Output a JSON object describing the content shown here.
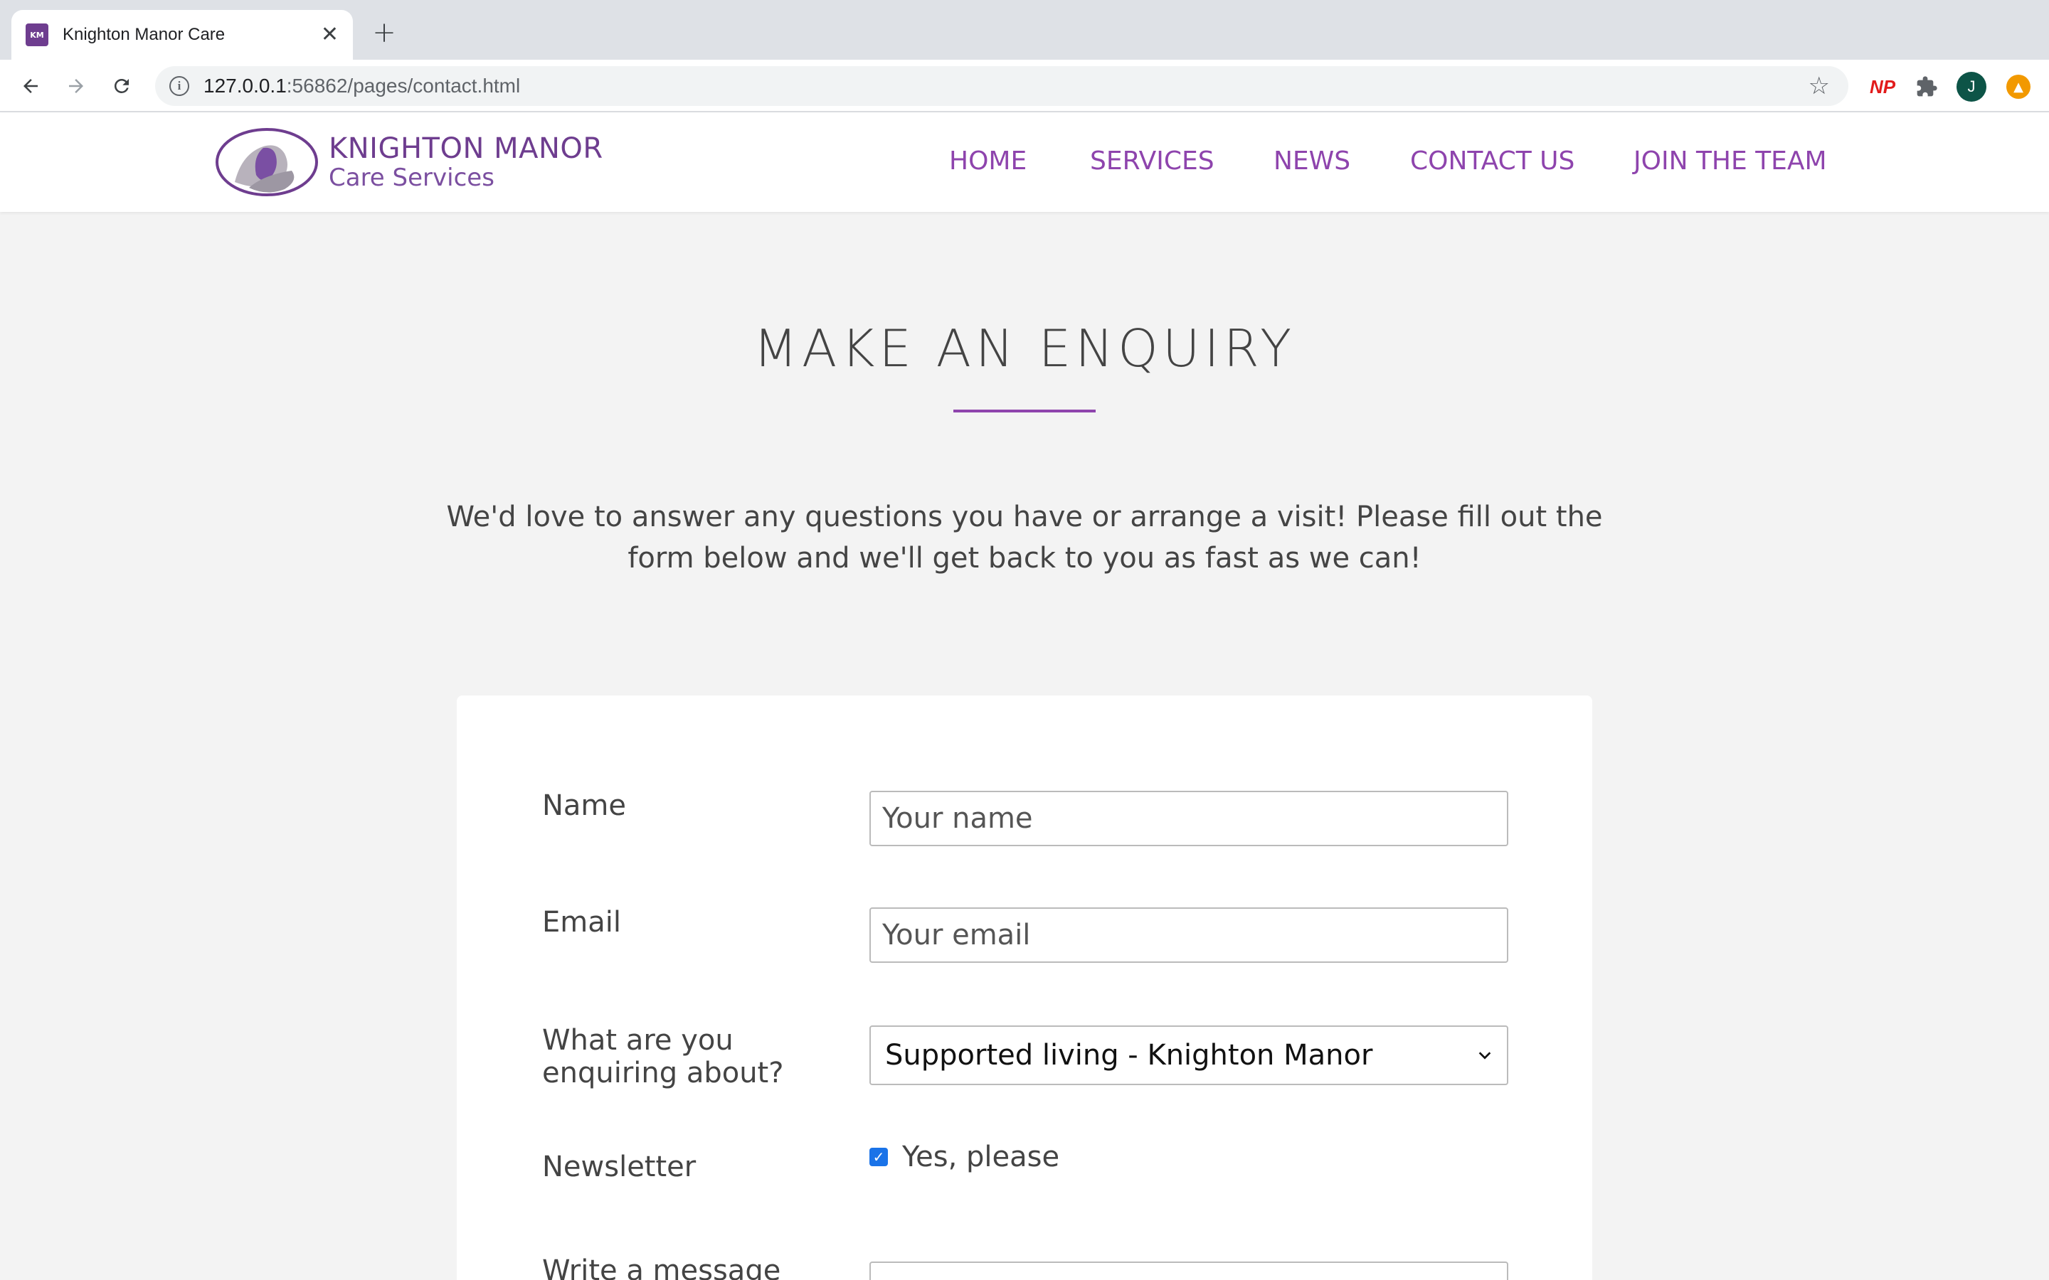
{
  "browser": {
    "tab_title": "Knighton Manor Care",
    "favicon_text": "KM",
    "url_host": "127.0.0.1",
    "url_rest": ":56862/pages/contact.html",
    "extensions": {
      "np_label": "NP",
      "avatar_initial": "J"
    }
  },
  "site": {
    "logo_line1": "KNIGHTON MANOR",
    "logo_line2": "Care Services",
    "nav": [
      {
        "label": "HOME"
      },
      {
        "label": "SERVICES"
      },
      {
        "label": "NEWS"
      },
      {
        "label": "CONTACT US"
      },
      {
        "label": "JOIN THE TEAM"
      }
    ],
    "brand_color": "#8e44ad"
  },
  "page": {
    "heading": "MAKE AN ENQUIRY",
    "intro": "We'd love to answer any questions you have or arrange a visit! Please fill out the form below and we'll get back to you as fast as we can!"
  },
  "form": {
    "name_label": "Name",
    "name_placeholder": "Your name",
    "email_label": "Email",
    "email_placeholder": "Your email",
    "enquiry_label_line1": "What are you",
    "enquiry_label_line2": "enquiring about?",
    "enquiry_selected": "Supported living - Knighton Manor",
    "newsletter_label": "Newsletter",
    "newsletter_option": "Yes, please",
    "newsletter_checked": true,
    "message_label": "Write a message"
  }
}
